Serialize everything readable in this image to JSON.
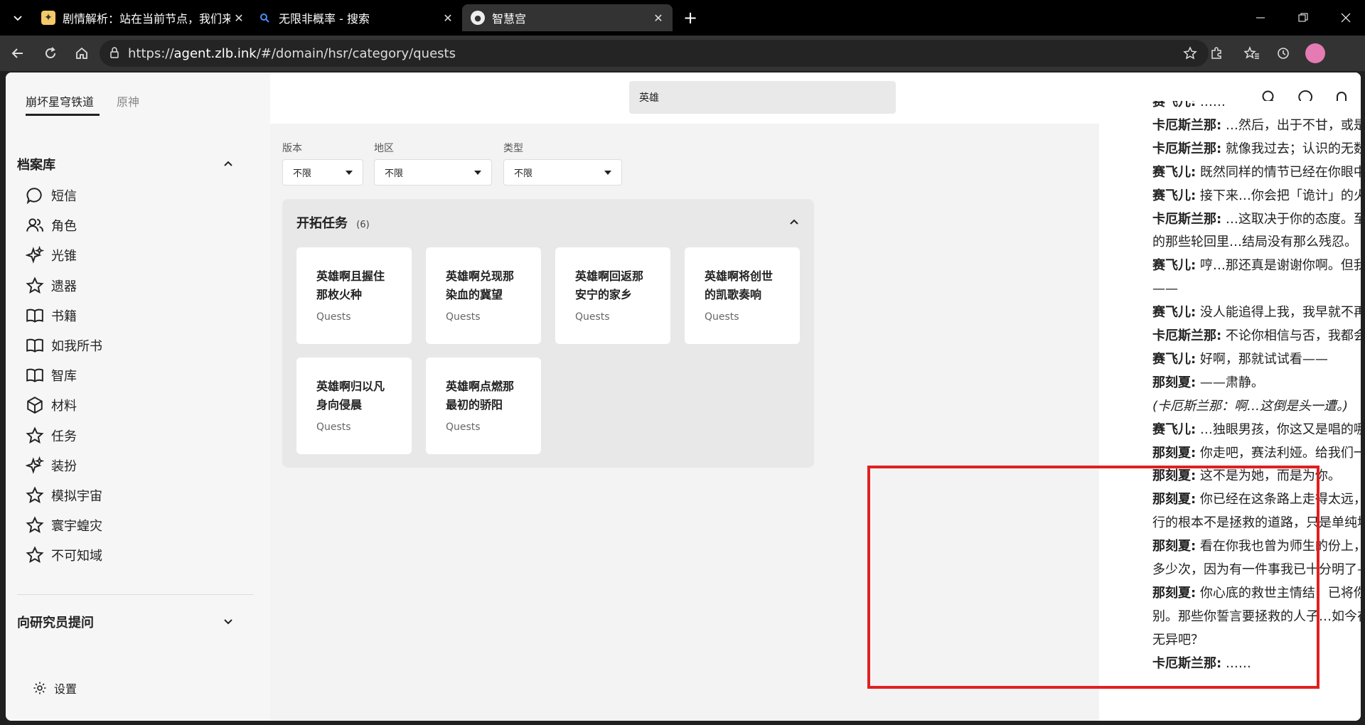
{
  "browser": {
    "tabs": [
      {
        "label": "剧情解析：站在当前节点，我们来",
        "icon": "app-favicon"
      },
      {
        "label": "无限非概率 - 搜索",
        "icon": "search-favicon"
      },
      {
        "label": "智慧宫",
        "icon": "zhihuigong-favicon"
      }
    ],
    "url_prefix": "https://",
    "url_host": "agent.zlb.ink",
    "url_path": "/#/domain/hsr/category/quests"
  },
  "sidebar": {
    "game_tabs": [
      "崩坏星穹铁道",
      "原神"
    ],
    "archive_title": "档案库",
    "items": [
      {
        "label": "短信",
        "icon": "chat-bubble-icon"
      },
      {
        "label": "角色",
        "icon": "users-icon"
      },
      {
        "label": "光锥",
        "icon": "sparkles-icon"
      },
      {
        "label": "遗器",
        "icon": "star-icon"
      },
      {
        "label": "书籍",
        "icon": "book-icon"
      },
      {
        "label": "如我所书",
        "icon": "book-icon"
      },
      {
        "label": "智库",
        "icon": "book-icon"
      },
      {
        "label": "材料",
        "icon": "cube-icon"
      },
      {
        "label": "任务",
        "icon": "star-icon"
      },
      {
        "label": "装扮",
        "icon": "sparkles-icon"
      },
      {
        "label": "模拟宇宙",
        "icon": "star-icon"
      },
      {
        "label": "寰宇蝗灾",
        "icon": "star-icon"
      },
      {
        "label": "不可知域",
        "icon": "star-icon"
      }
    ],
    "ask_title": "向研究员提问",
    "settings_label": "设置"
  },
  "header": {
    "search_value": "英雄"
  },
  "filters": [
    {
      "label": "版本",
      "value": "不限"
    },
    {
      "label": "地区",
      "value": "不限"
    },
    {
      "label": "类型",
      "value": "不限"
    }
  ],
  "quests": {
    "title": "开拓任务",
    "count": "(6)",
    "cards": [
      {
        "title": "英雄啊且握住那枚火种",
        "type": "Quests"
      },
      {
        "title": "英雄啊兑现那染血的冀望",
        "type": "Quests"
      },
      {
        "title": "英雄啊回返那安宁的家乡",
        "type": "Quests"
      },
      {
        "title": "英雄啊将创世的凯歌奏响",
        "type": "Quests"
      },
      {
        "title": "英雄啊归以凡身向侵晨",
        "type": "Quests"
      },
      {
        "title": "英雄啊点燃那最初的骄阳",
        "type": "Quests"
      }
    ]
  },
  "dialog": {
    "lines": [
      {
        "speaker": "赛飞儿:",
        "text": " ……"
      },
      {
        "speaker": "卡厄斯兰那:",
        "text": " …然后，出于不甘，或是仇恨，再度站在我的面前。"
      },
      {
        "speaker": "卡厄斯兰那:",
        "text": " 就像我过去；认识的无数个她们…既狡猾，又天真。"
      },
      {
        "speaker": "赛飞儿:",
        "text": " 既然同样的情节已经在你眼中上演了无数次，告诉我……"
      },
      {
        "speaker": "赛飞儿:",
        "text": " 接下来…你会把「诡计」的火种从我胸口剜出来吗？"
      },
      {
        "speaker": "卡厄斯兰那:",
        "text": " …这取决于你的态度。至少目前为止，在你问出了这句话"
      },
      {
        "speaker": "",
        "text": "的那些轮回里…结局没有那么残忍。"
      },
      {
        "speaker": "赛飞儿:",
        "text": " 哼…那还真是谢谢你啊。但我同样相信，这一次你追不上我"
      },
      {
        "speaker": "",
        "text": "——"
      },
      {
        "speaker": "赛飞儿:",
        "text": " 没人能追得上我，我早就不再为「逃亡」而奔跑了。"
      },
      {
        "speaker": "卡厄斯兰那:",
        "text": " 不论你相信与否，我都会告诉你，这是个错误的决定。"
      },
      {
        "speaker": "赛飞儿:",
        "text": " 好啊，那就试试看——"
      },
      {
        "speaker": "那刻夏:",
        "text": " ——肃静。"
      },
      {
        "speaker": "",
        "text": "(卡厄斯兰那：啊…这倒是头一遭。)",
        "italic": true
      },
      {
        "speaker": "赛飞儿:",
        "text": " …独眼男孩，你这又是唱的哪一出？"
      },
      {
        "speaker": "那刻夏:",
        "text": " 你走吧，赛法利娅。给我们一点私人时间。"
      },
      {
        "speaker": "那刻夏:",
        "text": " 这不是为她，而是为你。"
      },
      {
        "speaker": "那刻夏:",
        "text": " 你已经在这条路上走得太远，该讨论一种可能性了：也许你所"
      },
      {
        "speaker": "",
        "text": "行的根本不是拯救的道路，只是单纯地把这世界拖入火海而已。"
      },
      {
        "speaker": "那刻夏:",
        "text": " 看在你我也曾为师生的份上，回头吧。我不在乎你已经尝试了"
      },
      {
        "speaker": "",
        "text": "多少次，因为有一件事我已十分明了——"
      },
      {
        "speaker": "那刻夏:",
        "text": " 你心底的救世主情结，已将你变得与你口中冷眼的神明并无区"
      },
      {
        "speaker": "",
        "text": "别。那些你誓言要拯救的人子…如今在你眼里，他们的性命恐怕与蝼蚁"
      },
      {
        "speaker": "",
        "text": "无异吧？"
      },
      {
        "speaker": "卡厄斯兰那:",
        "text": " ……"
      }
    ]
  },
  "colors": {
    "highlight": "#e02020"
  }
}
